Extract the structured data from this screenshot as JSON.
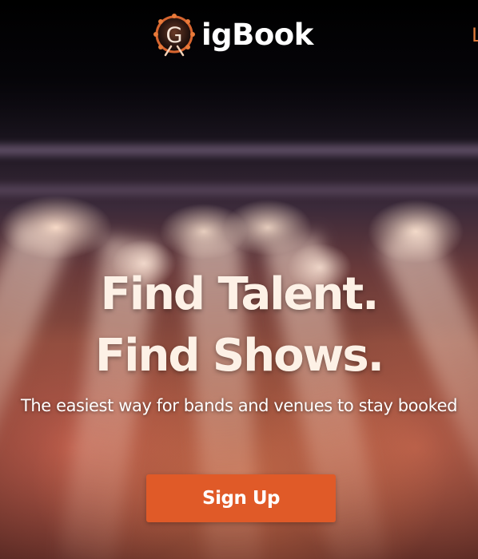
{
  "brand": {
    "name": "igBook",
    "logo_letter": "G",
    "accent_color": "#e05a28"
  },
  "nav": {
    "login_label": "L"
  },
  "hero": {
    "headline_line1": "Find Talent.",
    "headline_line2": "Find Shows.",
    "subheadline": "The easiest way for bands and venues to stay booked",
    "cta_label": "Sign Up"
  }
}
